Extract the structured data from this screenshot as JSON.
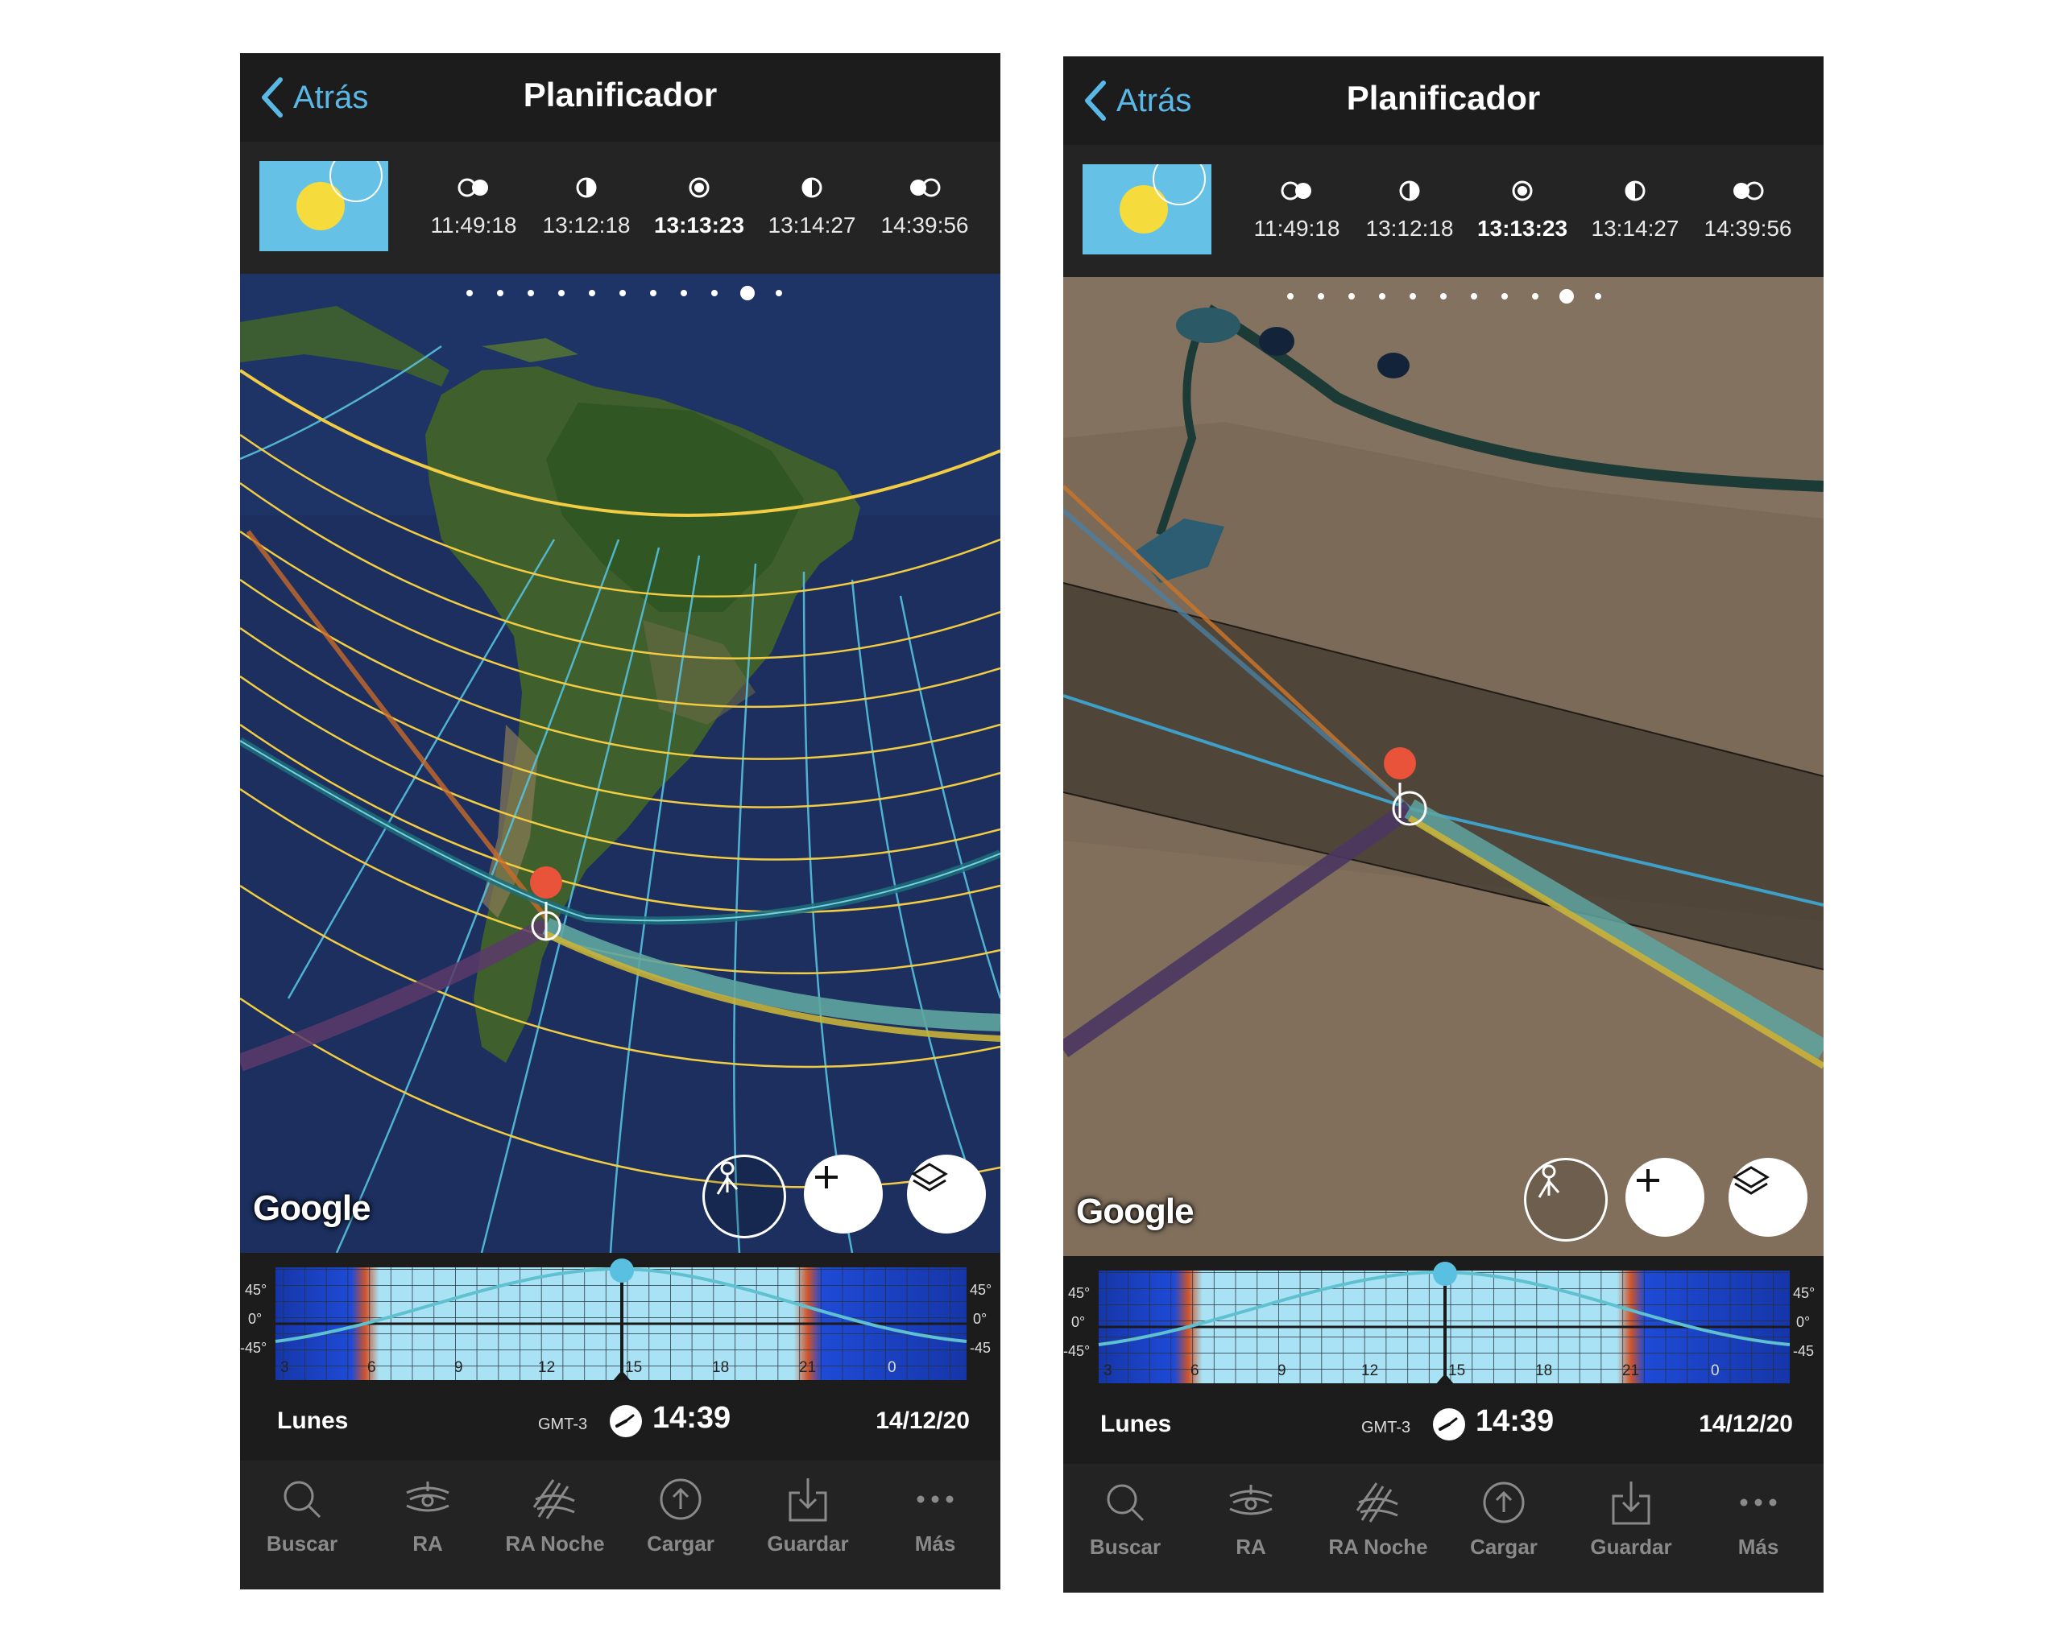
{
  "screens": [
    {
      "nav": {
        "back_label": "Atrás",
        "title": "Planificador"
      },
      "phases": [
        {
          "icon": "eclipse-first-contact-icon",
          "time": "11:49:18"
        },
        {
          "icon": "eclipse-second-contact-icon",
          "time": "13:12:18"
        },
        {
          "icon": "eclipse-maximum-icon",
          "time": "13:13:23",
          "active": true
        },
        {
          "icon": "eclipse-third-contact-icon",
          "time": "13:14:27"
        },
        {
          "icon": "eclipse-fourth-contact-icon",
          "time": "14:39:56"
        }
      ],
      "map": {
        "view": "South America satellite",
        "attribution": "Google",
        "page_dots": 11,
        "active_dot": 10
      },
      "chart": {
        "y_labels": [
          "45°",
          "0°",
          "-45°"
        ],
        "y_labels_right": [
          "45°",
          "0°",
          "-45"
        ],
        "x_labels": [
          "3",
          "6",
          "9",
          "12",
          "15",
          "18",
          "21",
          "0"
        ]
      },
      "info": {
        "day": "Lunes",
        "tz": "GMT-3",
        "time": "14:39",
        "date": "14/12/20"
      },
      "tabs": [
        {
          "label": "Buscar",
          "icon": "search-icon"
        },
        {
          "label": "RA",
          "icon": "ar-icon"
        },
        {
          "label": "RA Noche",
          "icon": "ar-night-icon"
        },
        {
          "label": "Cargar",
          "icon": "upload-icon"
        },
        {
          "label": "Guardar",
          "icon": "save-icon"
        },
        {
          "label": "Más",
          "icon": "more-icon"
        }
      ]
    },
    {
      "nav": {
        "back_label": "Atrás",
        "title": "Planificador"
      },
      "phases": [
        {
          "icon": "eclipse-first-contact-icon",
          "time": "11:49:18"
        },
        {
          "icon": "eclipse-second-contact-icon",
          "time": "13:12:18"
        },
        {
          "icon": "eclipse-maximum-icon",
          "time": "13:13:23",
          "active": true
        },
        {
          "icon": "eclipse-third-contact-icon",
          "time": "13:14:27"
        },
        {
          "icon": "eclipse-fourth-contact-icon",
          "time": "14:39:56"
        }
      ],
      "map": {
        "view": "terrain satellite close-up",
        "attribution": "Google",
        "page_dots": 11,
        "active_dot": 9
      },
      "chart": {
        "y_labels": [
          "45°",
          "0°",
          "-45°"
        ],
        "y_labels_right": [
          "45°",
          "0°",
          "-45"
        ],
        "x_labels": [
          "3",
          "6",
          "9",
          "12",
          "15",
          "18",
          "21",
          "0"
        ]
      },
      "info": {
        "day": "Lunes",
        "tz": "GMT-3",
        "time": "14:39",
        "date": "14/12/20"
      },
      "tabs": [
        {
          "label": "Buscar",
          "icon": "search-icon"
        },
        {
          "label": "RA",
          "icon": "ar-icon"
        },
        {
          "label": "RA Noche",
          "icon": "ar-night-icon"
        },
        {
          "label": "Cargar",
          "icon": "upload-icon"
        },
        {
          "label": "Guardar",
          "icon": "save-icon"
        },
        {
          "label": "Más",
          "icon": "more-icon"
        }
      ]
    }
  ]
}
